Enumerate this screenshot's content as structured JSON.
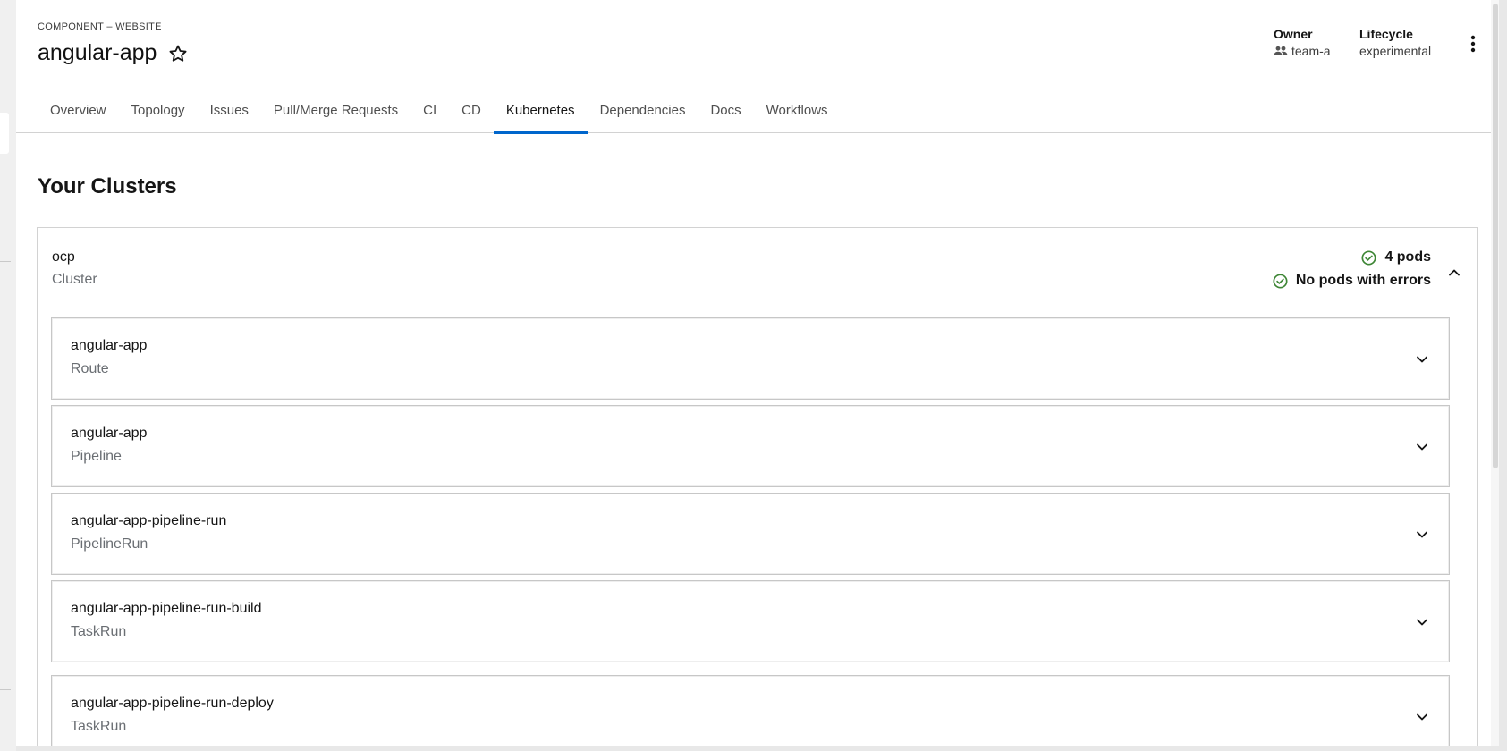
{
  "header": {
    "eyebrow": "COMPONENT – WEBSITE",
    "title": "angular-app",
    "owner_label": "Owner",
    "owner_value": "team-a",
    "lifecycle_label": "Lifecycle",
    "lifecycle_value": "experimental"
  },
  "tabs": [
    {
      "label": "Overview",
      "active": false
    },
    {
      "label": "Topology",
      "active": false
    },
    {
      "label": "Issues",
      "active": false
    },
    {
      "label": "Pull/Merge Requests",
      "active": false
    },
    {
      "label": "CI",
      "active": false
    },
    {
      "label": "CD",
      "active": false
    },
    {
      "label": "Kubernetes",
      "active": true
    },
    {
      "label": "Dependencies",
      "active": false
    },
    {
      "label": "Docs",
      "active": false
    },
    {
      "label": "Workflows",
      "active": false
    }
  ],
  "section_title": "Your Clusters",
  "cluster": {
    "name": "ocp",
    "type": "Cluster",
    "pods_status": "4 pods",
    "errors_status": "No pods with errors",
    "status_color": "#3e8635",
    "expanded": true,
    "resources": [
      {
        "name": "angular-app",
        "kind": "Route"
      },
      {
        "name": "angular-app",
        "kind": "Pipeline"
      },
      {
        "name": "angular-app-pipeline-run",
        "kind": "PipelineRun"
      },
      {
        "name": "angular-app-pipeline-run-build",
        "kind": "TaskRun"
      },
      {
        "name": "angular-app-pipeline-run-deploy",
        "kind": "TaskRun"
      }
    ]
  },
  "colors": {
    "accent": "#0066cc",
    "success": "#3e8635"
  }
}
